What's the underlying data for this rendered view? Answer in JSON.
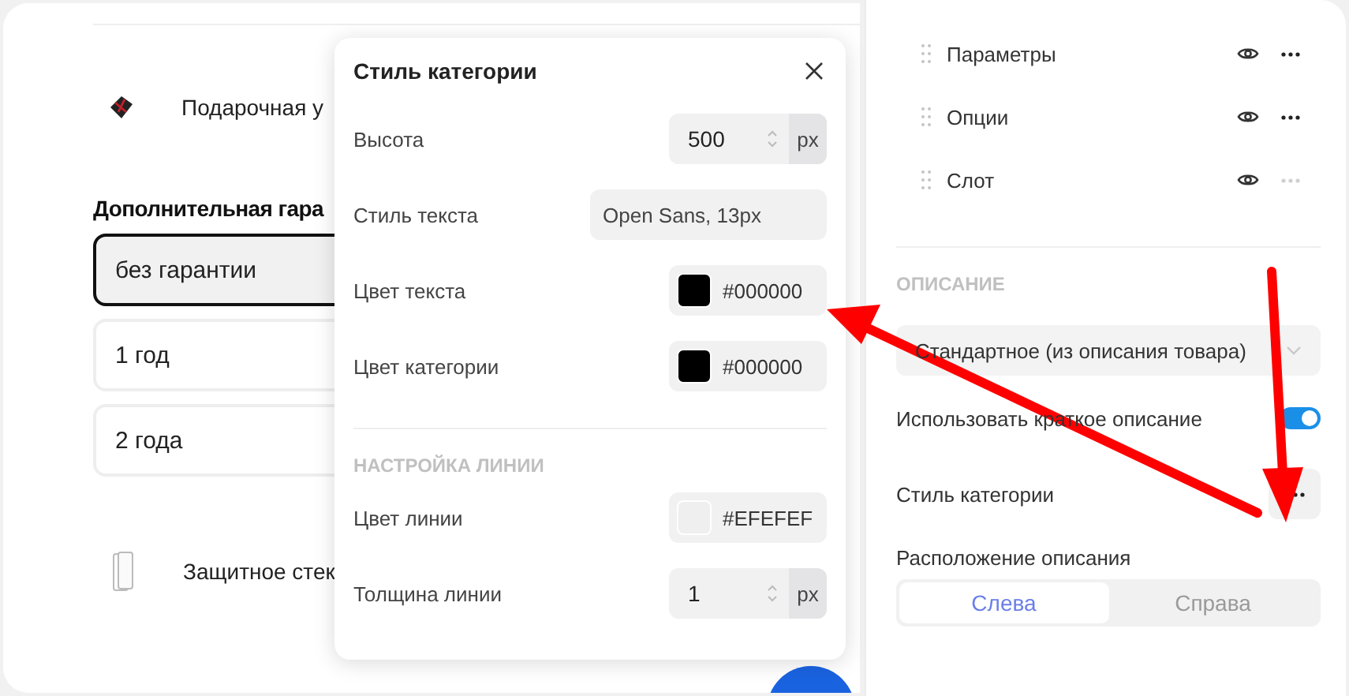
{
  "product_list": {
    "gift_item": {
      "label": "Подарочная у"
    },
    "warranty": {
      "heading": "Дополнительная гара",
      "options": [
        {
          "label": "без гарантии",
          "selected": true
        },
        {
          "label": "1 год",
          "selected": false
        },
        {
          "label": "2 года",
          "selected": false
        }
      ]
    },
    "glass_item": {
      "label": "Защитное стек"
    }
  },
  "popup": {
    "title": "Стиль категории",
    "rows": [
      {
        "kind": "number",
        "label": "Высота",
        "value": "500",
        "unit": "px"
      },
      {
        "kind": "text",
        "label": "Стиль текста",
        "value": "Open Sans, 13px"
      },
      {
        "kind": "color",
        "label": "Цвет текста",
        "value": "#000000",
        "color": "#000000"
      },
      {
        "kind": "color",
        "label": "Цвет категории",
        "value": "#000000",
        "color": "#000000"
      },
      {
        "kind": "section",
        "label": "НАСТРОЙКА ЛИНИИ"
      },
      {
        "kind": "color",
        "label": "Цвет линии",
        "value": "#EFEFEF",
        "color": "#efefef"
      },
      {
        "kind": "number",
        "label": "Толщина линии",
        "value": "1",
        "unit": "px"
      }
    ]
  },
  "sidebar": {
    "items": [
      {
        "label": "Параметры",
        "menu_disabled": false
      },
      {
        "label": "Опции",
        "menu_disabled": false
      },
      {
        "label": "Слот",
        "menu_disabled": true
      }
    ],
    "description": {
      "heading": "ОПИСАНИЕ",
      "select": {
        "value": "Стандартное (из описания товара)"
      },
      "short_toggle": {
        "label": "Использовать краткое описание",
        "on": true
      },
      "category_style": {
        "label": "Стиль категории"
      },
      "position": {
        "label": "Расположение описания",
        "options": [
          {
            "label": "Слева",
            "selected": true
          },
          {
            "label": "Справа",
            "selected": false
          }
        ]
      }
    }
  }
}
